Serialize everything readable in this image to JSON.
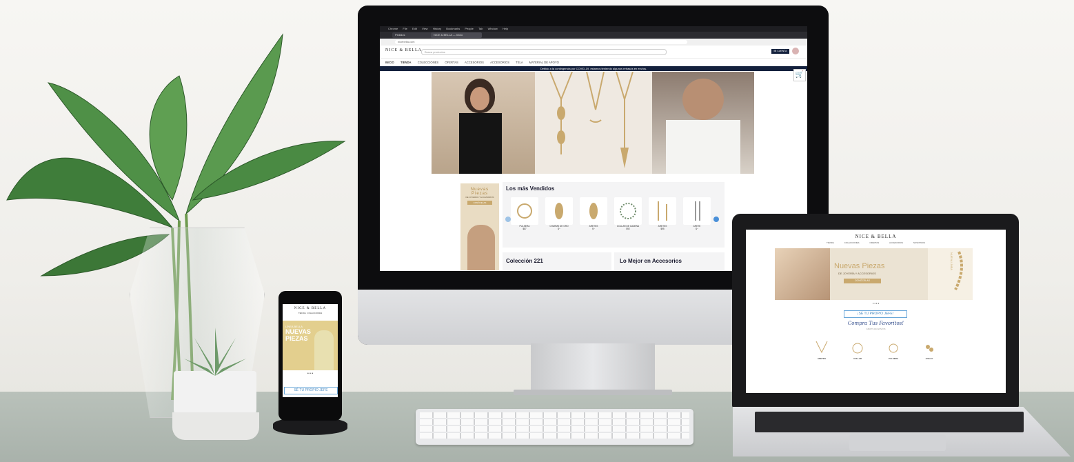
{
  "imac": {
    "menubar": [
      "Chrome",
      "File",
      "Edit",
      "View",
      "History",
      "Bookmarks",
      "People",
      "Tab",
      "Window",
      "Help"
    ],
    "tabs": [
      "Pedidos",
      "NICE & BELLA — Inicio"
    ],
    "url": "nicebella.com",
    "site": {
      "logo": "NICE & BELLA",
      "search_placeholder": "Busca productos",
      "nav": [
        "INICIO",
        "TIENDA",
        "COLECCIONES",
        "OFERTAS",
        "ACCESORIOS",
        "ACCESORIOS",
        "TELA",
        "MATERIAL DE APOYO"
      ],
      "account_badge": "MI CUENTA",
      "banner": "Debido a la contingencia por COVID-19, estamos teniendo algunos retrasos en envíos.",
      "promo_side": {
        "title_line1": "Nuevas",
        "title_line2": "Piezas",
        "subtitle": "DE JOYERÍA Y ACCESORIOS",
        "cta": "CONÓCELAS"
      },
      "best_sellers_title": "Los más Vendidos",
      "products": [
        {
          "name": "PULSERA",
          "price": "$87"
        },
        {
          "name": "CHARMS DE ORO",
          "price": "$~"
        },
        {
          "name": "ARETES",
          "price": "$~"
        },
        {
          "name": "COLLAR DE CADENA",
          "price": "$92"
        },
        {
          "name": "ARETES",
          "price": "$95"
        },
        {
          "name": "ARETE",
          "price": "$~"
        }
      ],
      "section_left": "Colección 221",
      "section_right": "Lo Mejor en Accesorios"
    }
  },
  "laptop": {
    "logo": "NICE & BELLA",
    "nav": [
      "TIENDA",
      "COLECCIONES",
      "OFERTAS",
      "ACCESORIOS",
      "NOSOTROS"
    ],
    "hero_title": "Nuevas Piezas",
    "hero_subtitle": "DE JOYERÍA Y ACCESORIOS",
    "hero_cta": "CONÓCELAS",
    "hero_side_text": "NUEVA LÍNEA",
    "boss_button": "¡SÉ TU PROPIO JEFE!",
    "script_heading": "Compra Tus Favoritos!",
    "script_sub": "GRATIS EN ENVÍOS",
    "products": [
      "ARETES",
      "COLLAR",
      "PULSERA",
      "ANILLO"
    ]
  },
  "phone": {
    "logo": "NICE & BELLA",
    "nav": [
      "TIENDA",
      "COLECCIONES"
    ],
    "hero_kicker": "LÍNEA BELLA",
    "hero_title_1": "NUEVAS",
    "hero_title_2": "PIEZAS",
    "boss_button": "SÉ TU PROPIO JEFE"
  },
  "colors": {
    "navy": "#14213d",
    "gold": "#c9a96e",
    "leaf": "#3d7b3c",
    "desk": "#b1bab3"
  }
}
